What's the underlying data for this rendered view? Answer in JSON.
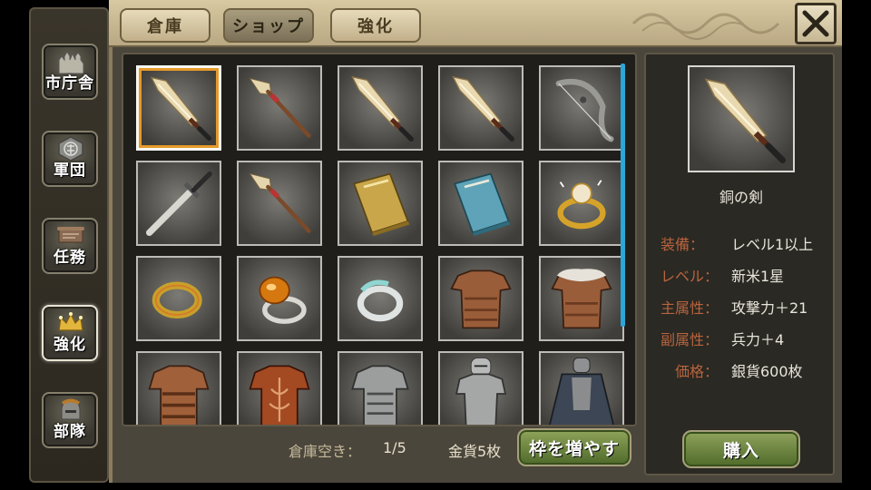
{
  "tabs": [
    {
      "label": "倉庫"
    },
    {
      "label": "ショップ",
      "active": true
    },
    {
      "label": "強化"
    }
  ],
  "sidebar": {
    "items": [
      {
        "label": "市庁舎",
        "icon": "castle-icon"
      },
      {
        "label": "軍団",
        "icon": "emblem-icon"
      },
      {
        "label": "任務",
        "icon": "scroll-board-icon"
      },
      {
        "label": "強化",
        "icon": "crown-icon",
        "active": true
      },
      {
        "label": "部隊",
        "icon": "helmet-icon"
      }
    ]
  },
  "grid": {
    "items": [
      {
        "name": "sword-icon",
        "selected": true
      },
      {
        "name": "spear-icon"
      },
      {
        "name": "sword-icon"
      },
      {
        "name": "sword-icon"
      },
      {
        "name": "bow-icon"
      },
      {
        "name": "longsword-icon"
      },
      {
        "name": "spear-icon"
      },
      {
        "name": "gold-book-icon"
      },
      {
        "name": "blue-book-icon"
      },
      {
        "name": "pearl-ring-icon"
      },
      {
        "name": "gold-ring-icon"
      },
      {
        "name": "amber-ring-icon"
      },
      {
        "name": "silver-ring-icon"
      },
      {
        "name": "leather-armor-icon"
      },
      {
        "name": "fur-armor-icon"
      },
      {
        "name": "bronze-armor-icon"
      },
      {
        "name": "ornate-armor-icon"
      },
      {
        "name": "plate-armor-icon"
      },
      {
        "name": "knight-armor-icon"
      },
      {
        "name": "cloak-armor-icon"
      }
    ]
  },
  "footer": {
    "storage_label": "倉庫空き：",
    "storage_value": "1/5",
    "gold_label": "金貨5枚",
    "expand_button": "枠を増やす"
  },
  "detail": {
    "icon": "sword-icon",
    "name": "銅の剣",
    "stats": [
      {
        "key": "装備：",
        "value": "レベル1以上"
      },
      {
        "key": "レベル：",
        "value": "新米1星"
      },
      {
        "key": "主属性：",
        "value": "攻撃力＋21"
      },
      {
        "key": "副属性：",
        "value": "兵力＋4"
      },
      {
        "key": "価格：",
        "value": "銀貨600枚"
      }
    ],
    "buy_button": "購入"
  },
  "colors": {
    "accent_gold": "#e79a2a",
    "scrollbar": "#2aa6d8",
    "button_green": "#6b8a3c",
    "stat_label": "#b8643e"
  }
}
